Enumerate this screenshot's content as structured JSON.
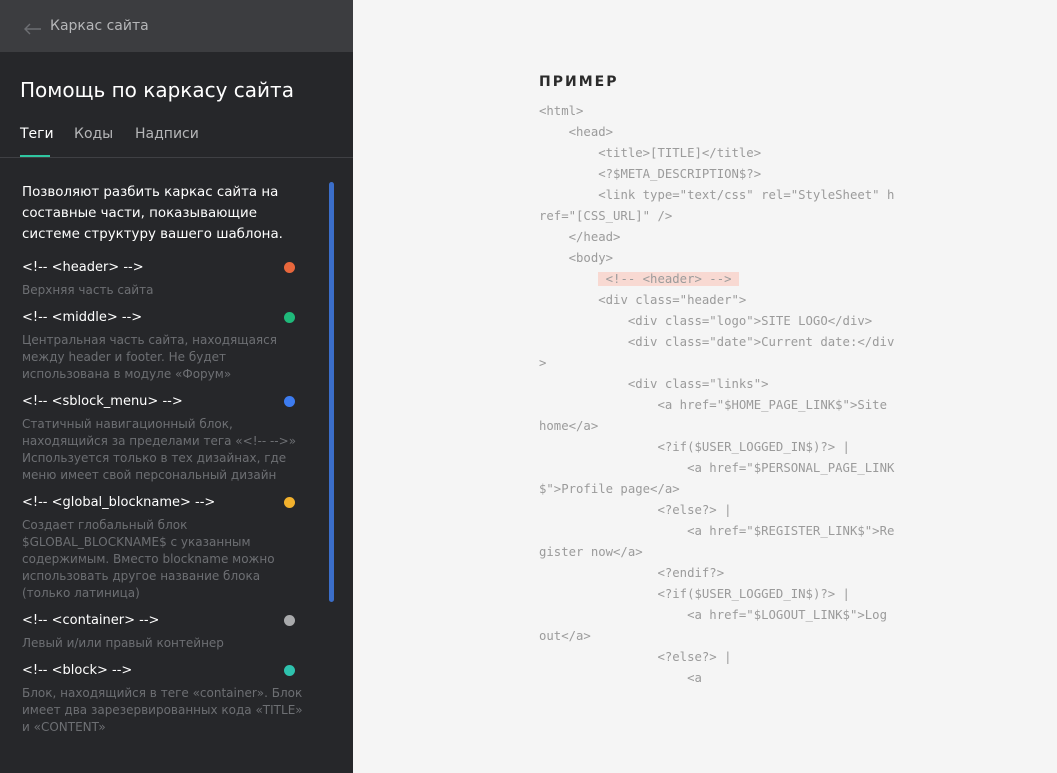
{
  "topbar": {
    "back_label": "Каркас сайта"
  },
  "panel": {
    "title": "Помощь по каркасу сайта"
  },
  "tabs": [
    {
      "label": "Теги",
      "active": true
    },
    {
      "label": "Коды",
      "active": false
    },
    {
      "label": "Надписи",
      "active": false
    }
  ],
  "intro": "Позволяют разбить каркас сайта на составные части, показывающие системе структуру вашего шаблона.",
  "tags": [
    {
      "name": "<!-- <header> -->",
      "desc": "Верхняя часть сайта",
      "color": "#e8673c"
    },
    {
      "name": "<!-- <middle> -->",
      "desc": "Центральная часть сайта, находящаяся между header и footer. Не будет использована в модуле «Форум»",
      "color": "#1fb97a"
    },
    {
      "name": "<!-- <sblock_menu> -->",
      "desc": "Статичный навигационный блок, находящийся за пределами тега «<!-- -->» Используется только в тех дизайнах, где меню имеет свой персональный дизайн",
      "color": "#3d7cf0"
    },
    {
      "name": "<!-- <global_blockname> -->",
      "desc": "Создает глобальный блок $GLOBAL_BLOCKNAME$ с указанным содержимым. Вместо blockname можно использовать другое название блока (только латиница)",
      "color": "#f2b12d"
    },
    {
      "name": "<!-- <container> -->",
      "desc": "Левый и/или правый контейнер",
      "color": "#a9aaac"
    },
    {
      "name": "<!-- <block> -->",
      "desc": "Блок, находящийся в теге «container». Блок имеет два зарезервированных кода «TITLE» и «CONTENT»",
      "color": "#2ec2ae"
    }
  ],
  "example": {
    "label": "ПРИМЕР",
    "code_before": "<html>\n    <head>\n        <title>[TITLE]</title>\n        <?$META_DESCRIPTION$?>\n        <link type=\"text/css\" rel=\"StyleSheet\" href=\"[CSS_URL]\" />\n    </head>\n    <body>\n        ",
    "code_highlight": " <!-- <header> --> ",
    "code_after": "\n        <div class=\"header\">\n            <div class=\"logo\">SITE LOGO</div>\n            <div class=\"date\">Current date:</div>\n            <div class=\"links\">\n                <a href=\"$HOME_PAGE_LINK$\">Site home</a>\n                <?if($USER_LOGGED_IN$)?> |\n                    <a href=\"$PERSONAL_PAGE_LINK$\">Profile page</a>\n                <?else?> |\n                    <a href=\"$REGISTER_LINK$\">Register now</a>\n                <?endif?>\n                <?if($USER_LOGGED_IN$)?> |\n                    <a href=\"$LOGOUT_LINK$\">Log out</a>\n                <?else?> |\n                    <a"
  },
  "icons": {
    "back": "arrow-left-icon"
  }
}
